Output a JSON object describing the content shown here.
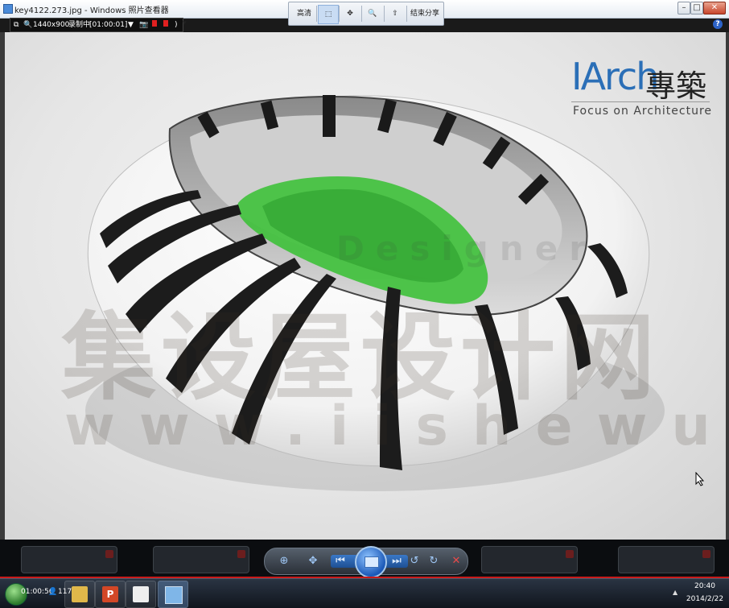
{
  "window": {
    "title": "key4122.273.jpg - Windows 照片查看器",
    "minimize": "–",
    "maximize": "□",
    "close": "✕"
  },
  "recorder": {
    "size": "1440x900",
    "status": "录制中",
    "time": "[01:00:01]"
  },
  "share_toolbar": {
    "hd_label": "高清",
    "end_share_label": "结束分享"
  },
  "logo": {
    "brand": "IArch",
    "chinese": "專築",
    "tagline": "Focus on Architecture"
  },
  "watermark": {
    "site_cn": "集设屋设计网",
    "url": "www.iishewu.com",
    "designer": "Designer"
  },
  "taskbar": {
    "recording_time": "01:00:56",
    "count": "117",
    "clock_time": "20:40",
    "clock_date": "2014/2/22"
  },
  "colors": {
    "field_green": "#3ec13a",
    "accent_blue": "#2d63c8",
    "record_red": "#e02020"
  }
}
